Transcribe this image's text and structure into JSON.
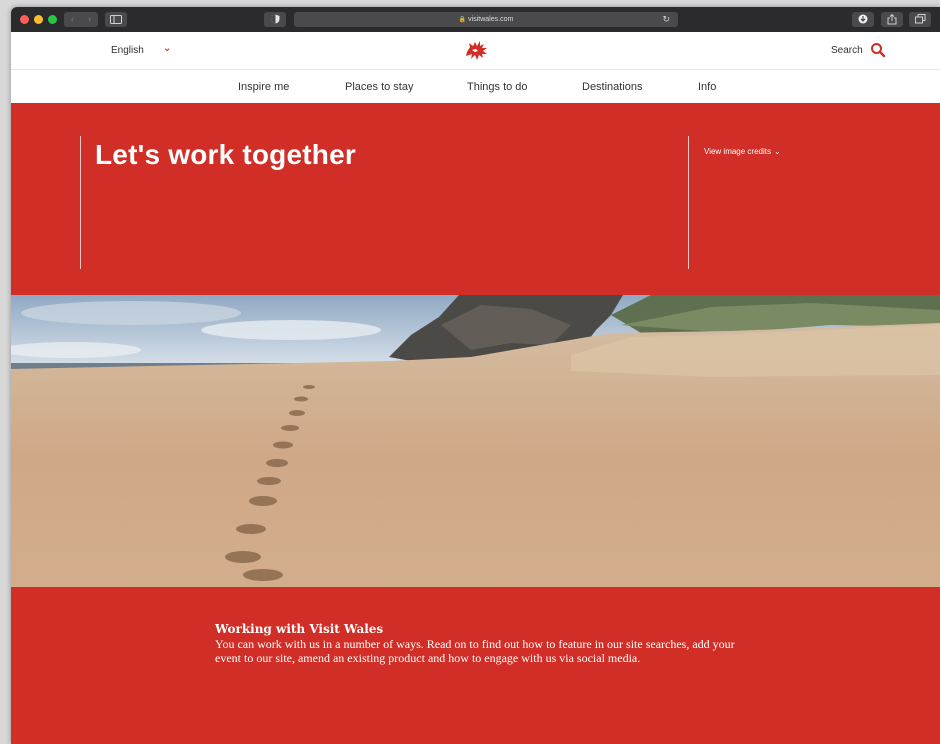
{
  "browser": {
    "url": "visitwales.com",
    "lock_glyph": "🔒",
    "back_glyph": "‹",
    "forward_glyph": "›",
    "reload_glyph": "↻",
    "icons": [
      "close-dot",
      "minimize-dot",
      "maximize-dot",
      "back-arrow-icon",
      "forward-arrow-icon",
      "sidebar-icon",
      "shield-icon",
      "lock-icon",
      "reload-icon",
      "download-icon",
      "share-icon",
      "tabs-icon"
    ]
  },
  "header": {
    "language": "English",
    "language_chevron": "⌄",
    "search_label": "Search",
    "icons": [
      "chevron-down-icon",
      "welsh-dragon-logo",
      "search-icon"
    ]
  },
  "nav": {
    "items": [
      "Inspire me",
      "Places to stay",
      "Things to do",
      "Destinations",
      "Info"
    ]
  },
  "hero": {
    "title": "Let's work together",
    "credits": "View image credits",
    "credits_chevron": "⌄"
  },
  "content": {
    "heading": "Working with Visit Wales",
    "body": "You can work with us in a number of ways. Read on to find out how to feature in our site searches, add your event to our site, amend an existing product and how to engage with us via social media."
  },
  "colors": {
    "brand_red": "#d02e26",
    "chrome_dark": "#2b2b2d"
  }
}
